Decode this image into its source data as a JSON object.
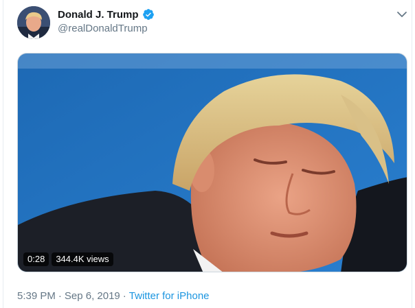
{
  "tweet": {
    "display_name": "Donald J. Trump",
    "handle": "@realDonaldTrump",
    "time": "5:39 PM",
    "date": "Sep 6, 2019",
    "separator": "·",
    "source": "Twitter for iPhone"
  },
  "video": {
    "duration": "0:28",
    "views": "344.4K views"
  },
  "icons": {
    "verified": "verified-badge-icon",
    "caret": "chevron-down-icon"
  },
  "colors": {
    "verified_blue": "#1da1f2",
    "link_blue": "#1b95e0",
    "muted_text": "#657786"
  }
}
